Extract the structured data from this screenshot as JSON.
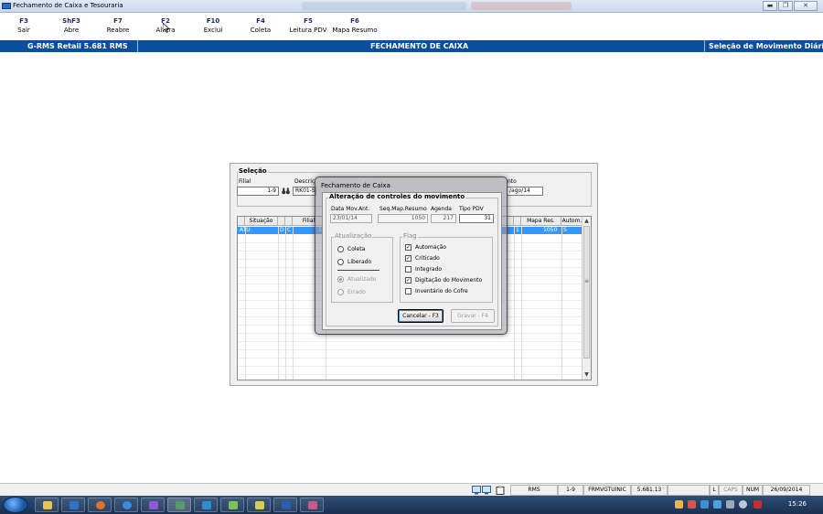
{
  "window": {
    "title": "Fechamento de Caixa e Tesouraria"
  },
  "toolbar": {
    "keys": [
      {
        "key": "F3",
        "label": "Sair"
      },
      {
        "key": "ShF3",
        "label": "Abre"
      },
      {
        "key": "F7",
        "label": "Reabre"
      },
      {
        "key": "F2",
        "label": "Altera"
      },
      {
        "key": "F10",
        "label": "Exclui"
      },
      {
        "key": "F4",
        "label": "Coleta"
      },
      {
        "key": "F5",
        "label": "Leitura PDV"
      },
      {
        "key": "F6",
        "label": "Mapa Resumo"
      }
    ]
  },
  "header": {
    "version": "G-RMS Retail 5.681 RMS",
    "center": "FECHAMENTO DE CAIXA",
    "right": "Seleção de Movimento Diário",
    "color": "#0a4e9c"
  },
  "selecao": {
    "title": "Seleção",
    "filial_label": "Filial",
    "filial_value": "1-9",
    "descricao_label": "Descriç",
    "descricao_value": "RK01-S",
    "movimento_label": "nto",
    "movimento_value": "/ago/14"
  },
  "grid": {
    "columns": {
      "situacao": "Situação",
      "filial": "Filial",
      "mapa": "Mapa Res.",
      "autom": "Autom."
    },
    "row": {
      "situacao": "ATU",
      "d": "D",
      "c": "C",
      "filial": "1-",
      "hidden": "1",
      "mapa": "1050",
      "autom": "S"
    },
    "selection_color": "#3399ff"
  },
  "dialog": {
    "title": "Fechamento de Caixa",
    "group_title": "Alteração de controles do movimento",
    "fields": {
      "data_label": "Data Mov.Ant.",
      "data_value": "23/01/14",
      "seq_label": "Seq.Map.Resumo",
      "seq_value": "1050",
      "agenda_label": "Agenda",
      "agenda_value": "217",
      "tipo_label": "Tipo PDV",
      "tipo_value": "31"
    },
    "atualizacao": {
      "title": "Atualização",
      "options": [
        "Coleta",
        "Liberado",
        "Atualizado",
        "Errado"
      ]
    },
    "flag": {
      "title": "Flag",
      "items": [
        {
          "label": "Automação",
          "mark": "✓"
        },
        {
          "label": "Criticado",
          "mark": "✓"
        },
        {
          "label": "Integrado",
          "mark": ""
        },
        {
          "label": "Digitação do Movimento",
          "mark": "✓"
        },
        {
          "label": "Inventário do Cofre",
          "mark": ""
        }
      ]
    },
    "buttons": {
      "cancel": "Cancelar - F3",
      "save": "Gravar - F4"
    }
  },
  "statusbar": {
    "rms": "RMS",
    "filial": "1-9",
    "program": "FRMVGTUINIC",
    "version": "5.681.13",
    "l": "L",
    "caps": "CAPS",
    "num": "NUM",
    "date": "26/09/2014"
  },
  "taskbar": {
    "time": "15:26"
  }
}
